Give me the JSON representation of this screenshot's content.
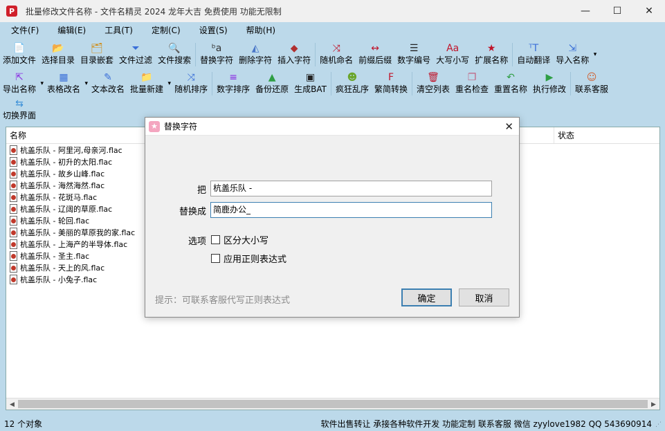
{
  "window": {
    "title": "批量修改文件名称 - 文件名精灵 2024 龙年大吉 免费使用 功能无限制",
    "app_icon_glyph": "P",
    "minimize": "—",
    "maximize": "☐",
    "close": "✕"
  },
  "menu": [
    "文件(F)",
    "编辑(E)",
    "工具(T)",
    "定制(C)",
    "设置(S)",
    "帮助(H)"
  ],
  "toolbar1": [
    {
      "label": "添加文件",
      "icon": "add-file-icon",
      "glyph": "📄",
      "color": "#2e7d32"
    },
    {
      "label": "选择目录",
      "icon": "folder-open-icon",
      "glyph": "📂",
      "color": "#e0a020"
    },
    {
      "label": "目录嵌套",
      "icon": "folder-nest-icon",
      "glyph": "🗂",
      "color": "#d08a10"
    },
    {
      "label": "文件过滤",
      "icon": "filter-icon",
      "glyph": "⏷",
      "color": "#3a6fd8"
    },
    {
      "label": "文件搜索",
      "icon": "search-icon",
      "glyph": "🔍",
      "color": "#555555"
    },
    {
      "label": "替换字符",
      "icon": "replace-text-icon",
      "glyph": "ᵇa",
      "color": "#333333"
    },
    {
      "label": "删除字符",
      "icon": "delete-text-icon",
      "glyph": "◭",
      "color": "#4a77c8"
    },
    {
      "label": "插入字符",
      "icon": "insert-text-icon",
      "glyph": "◆",
      "color": "#b03030"
    },
    {
      "label": "随机命名",
      "icon": "shuffle-icon",
      "glyph": "⤨",
      "color": "#c0142a"
    },
    {
      "label": "前缀后缀",
      "icon": "prefix-suffix-icon",
      "glyph": "↔",
      "color": "#c0142a"
    },
    {
      "label": "数字编号",
      "icon": "numbered-list-icon",
      "glyph": "☰",
      "color": "#222222"
    },
    {
      "label": "大写小写",
      "icon": "case-icon",
      "glyph": "Aa",
      "color": "#c0142a"
    },
    {
      "label": "扩展名称",
      "icon": "star-icon",
      "glyph": "★",
      "color": "#c0142a"
    },
    {
      "label": "自动翻译",
      "icon": "translate-icon",
      "glyph": "ᵀT",
      "color": "#3a6fd8"
    },
    {
      "label": "导入名称",
      "icon": "import-icon",
      "glyph": "⇲",
      "color": "#3a6fd8"
    }
  ],
  "toolbar2": [
    {
      "label": "导出名称",
      "icon": "export-icon",
      "glyph": "⇱",
      "color": "#8a2be2"
    },
    {
      "label": "表格改名",
      "icon": "table-icon",
      "glyph": "▦",
      "color": "#3a6fd8"
    },
    {
      "label": "文本改名",
      "icon": "edit-text-icon",
      "glyph": "✎",
      "color": "#3a6fd8"
    },
    {
      "label": "批量新建",
      "icon": "new-folder-icon",
      "glyph": "📁",
      "color": "#e0a020"
    },
    {
      "label": "随机排序",
      "icon": "random-sort-icon",
      "glyph": "⤨",
      "color": "#3a6fd8"
    },
    {
      "label": "数字排序",
      "icon": "number-sort-icon",
      "glyph": "≡",
      "color": "#8a2be2"
    },
    {
      "label": "备份还原",
      "icon": "drive-icon",
      "glyph": "▲",
      "color": "#2e9e44"
    },
    {
      "label": "生成BAT",
      "icon": "terminal-icon",
      "glyph": "▣",
      "color": "#222222"
    },
    {
      "label": "疯狂乱序",
      "icon": "frog-icon",
      "glyph": "☻",
      "color": "#6aa52a"
    },
    {
      "label": "繁简转换",
      "icon": "convert-icon",
      "glyph": "F",
      "color": "#c0142a"
    },
    {
      "label": "清空列表",
      "icon": "clear-list-icon",
      "glyph": "🗑",
      "color": "#c0142a"
    },
    {
      "label": "重名检查",
      "icon": "duplicate-check-icon",
      "glyph": "❐",
      "color": "#c06080"
    },
    {
      "label": "重置名称",
      "icon": "undo-icon",
      "glyph": "↶",
      "color": "#2e9e44"
    },
    {
      "label": "执行修改",
      "icon": "play-icon",
      "glyph": "▶",
      "color": "#2e9e44"
    },
    {
      "label": "联系客服",
      "icon": "support-icon",
      "glyph": "☺",
      "color": "#d06030"
    }
  ],
  "toolbar3": [
    {
      "label": "切换界面",
      "icon": "switch-view-icon",
      "glyph": "⇆",
      "color": "#3a8fd8"
    }
  ],
  "list": {
    "col_name": "名称",
    "col_status": "状态",
    "rows": [
      "杭盖乐队 - 阿里河,母亲河.flac",
      "杭盖乐队 - 初升的太阳.flac",
      "杭盖乐队 - 故乡山峰.flac",
      "杭盖乐队 - 海然海然.flac",
      "杭盖乐队 - 花斑马.flac",
      "杭盖乐队 - 辽阔的草原.flac",
      "杭盖乐队 - 轮回.flac",
      "杭盖乐队 - 美丽的草原我的家.flac",
      "杭盖乐队 - 上海产的半导体.flac",
      "杭盖乐队 - 圣主.flac",
      "杭盖乐队 - 天上的风.flac",
      "杭盖乐队 - 小兔子.flac"
    ]
  },
  "status": {
    "left": "12 个对象",
    "right": "软件出售转让 承接各种软件开发 功能定制 联系客服 微信 zyylove1982 QQ 543690914"
  },
  "dialog": {
    "title": "替换字符",
    "find_label": "把",
    "find_value": "杭盖乐队 -",
    "replace_label": "替换成",
    "replace_value": "简鹿办公_",
    "options_label": "选项",
    "opt_case": "区分大小写",
    "opt_regex": "应用正则表达式",
    "hint": "提示：可联系客服代写正则表达式",
    "ok": "确定",
    "cancel": "取消",
    "close": "✕"
  }
}
